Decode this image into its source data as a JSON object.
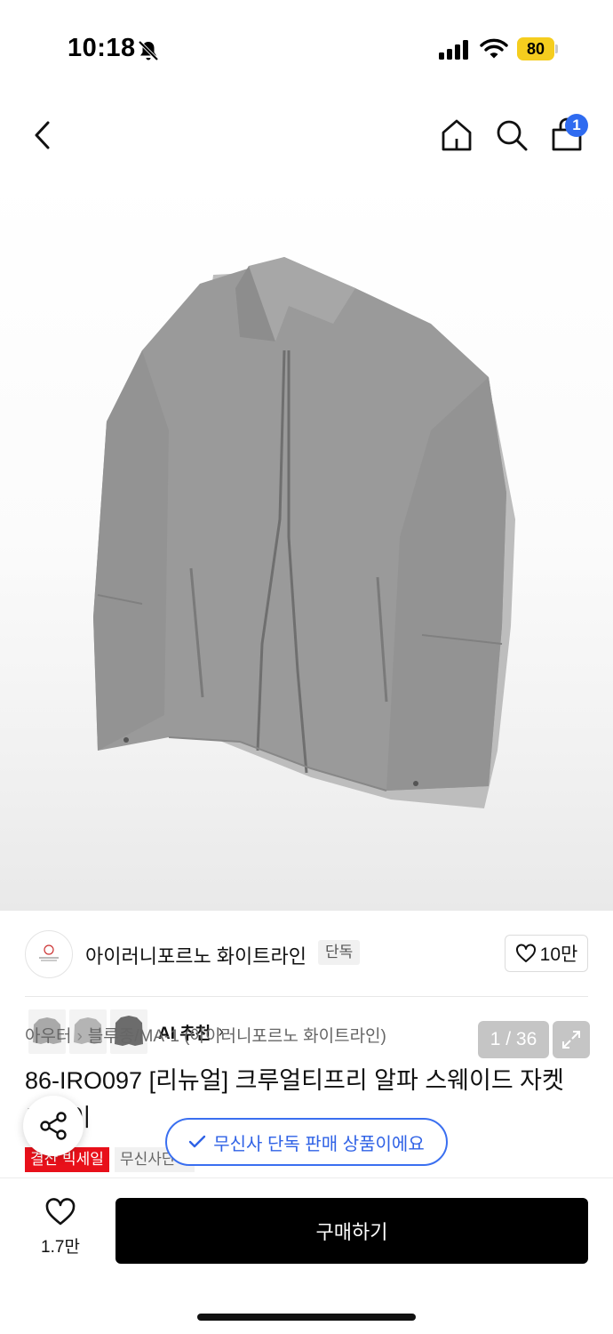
{
  "status_bar": {
    "time": "10:18",
    "battery": "80"
  },
  "header": {
    "cart_badge": "1"
  },
  "gallery": {
    "counter": "1 / 36",
    "ai_recommend_label": "AI 추천"
  },
  "brand": {
    "name": "아이러니포르노 화이트라인",
    "exclusive_tag": "단독",
    "likes": "10만"
  },
  "breadcrumb": {
    "level1": "아우터",
    "level2": "블루종/MA-1 (아이러니포르노 화이트라인)"
  },
  "product": {
    "title": "86-IRO097 [리뉴얼] 크루얼티프리 알파 스웨이드 자켓 그레이"
  },
  "toast": {
    "text": "무신사 단독 판매 상품이에요"
  },
  "tags": {
    "sale": "결산 빅세일",
    "musinsa": "무신사단독"
  },
  "bottom": {
    "wish_count": "1.7만",
    "buy_label": "구매하기"
  },
  "colors": {
    "accent_blue": "#2f6bf0",
    "sale_red": "#e8101a",
    "battery_yellow": "#f5cd1e"
  }
}
